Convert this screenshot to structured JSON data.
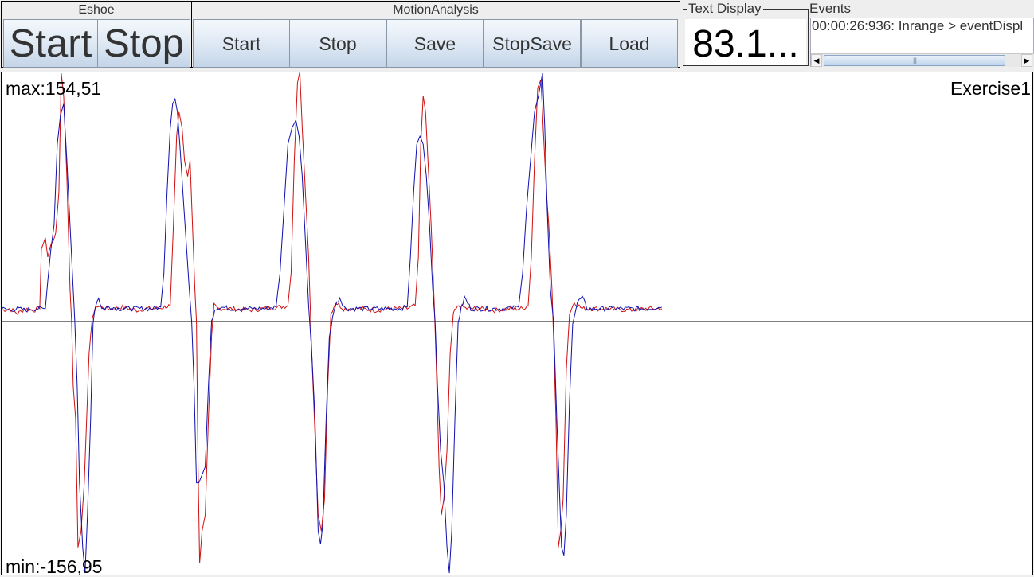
{
  "eshoe": {
    "title": "Eshoe",
    "start_label": "Start",
    "stop_label": "Stop"
  },
  "motion_analysis": {
    "title": "MotionAnalysis",
    "buttons": [
      "Start",
      "Stop",
      "Save",
      "StopSave",
      "Load"
    ]
  },
  "text_display": {
    "title": "Text Display",
    "value": "83.1..."
  },
  "events": {
    "title": "Events",
    "items": [
      "00:00:26:936: Inrange > eventDispl"
    ],
    "scroll_left_icon": "◀",
    "scroll_right_icon": "▶",
    "thumb_grip": "|||"
  },
  "colors": {
    "series_red": "#d01010",
    "series_blue": "#1010b0",
    "axis": "#000000"
  },
  "chart_data": {
    "type": "line",
    "title": "Exercise1",
    "max_label": "max:154,51",
    "min_label": "min:-156,95",
    "ylim": [
      -156.95,
      154.51
    ],
    "xlim": [
      0,
      1296
    ],
    "grid": false,
    "zero_line": true,
    "series": [
      {
        "name": "red",
        "color": "#d01010",
        "points": [
          [
            0,
            7
          ],
          [
            10,
            8
          ],
          [
            20,
            5
          ],
          [
            30,
            8
          ],
          [
            40,
            7
          ],
          [
            48,
            8
          ],
          [
            50,
            45
          ],
          [
            55,
            52
          ],
          [
            58,
            40
          ],
          [
            62,
            48
          ],
          [
            65,
            50
          ],
          [
            68,
            55
          ],
          [
            72,
            80
          ],
          [
            75,
            154
          ],
          [
            78,
            140
          ],
          [
            82,
            90
          ],
          [
            86,
            20
          ],
          [
            88,
            0
          ],
          [
            90,
            -40
          ],
          [
            93,
            -60
          ],
          [
            96,
            -140
          ],
          [
            100,
            -130
          ],
          [
            104,
            -100
          ],
          [
            110,
            -20
          ],
          [
            114,
            3
          ],
          [
            120,
            10
          ],
          [
            130,
            8
          ],
          [
            140,
            8
          ],
          [
            150,
            9
          ],
          [
            160,
            8
          ],
          [
            170,
            7
          ],
          [
            180,
            8
          ],
          [
            195,
            8
          ],
          [
            205,
            9
          ],
          [
            212,
            10
          ],
          [
            216,
            60
          ],
          [
            220,
            115
          ],
          [
            223,
            130
          ],
          [
            227,
            120
          ],
          [
            230,
            100
          ],
          [
            234,
            90
          ],
          [
            237,
            100
          ],
          [
            240,
            60
          ],
          [
            243,
            20
          ],
          [
            245,
            0
          ],
          [
            247,
            -90
          ],
          [
            249,
            -150
          ],
          [
            252,
            -130
          ],
          [
            256,
            -120
          ],
          [
            260,
            -60
          ],
          [
            264,
            -10
          ],
          [
            267,
            10
          ],
          [
            272,
            8
          ],
          [
            290,
            8
          ],
          [
            310,
            7
          ],
          [
            330,
            8
          ],
          [
            350,
            9
          ],
          [
            360,
            10
          ],
          [
            364,
            30
          ],
          [
            368,
            100
          ],
          [
            372,
            148
          ],
          [
            375,
            155
          ],
          [
            378,
            120
          ],
          [
            382,
            80
          ],
          [
            386,
            40
          ],
          [
            388,
            10
          ],
          [
            390,
            -20
          ],
          [
            394,
            -70
          ],
          [
            398,
            -120
          ],
          [
            402,
            -130
          ],
          [
            406,
            -110
          ],
          [
            410,
            -40
          ],
          [
            414,
            5
          ],
          [
            420,
            12
          ],
          [
            430,
            8
          ],
          [
            450,
            8
          ],
          [
            470,
            7
          ],
          [
            490,
            8
          ],
          [
            510,
            8
          ],
          [
            520,
            10
          ],
          [
            524,
            40
          ],
          [
            527,
            110
          ],
          [
            530,
            140
          ],
          [
            533,
            130
          ],
          [
            536,
            100
          ],
          [
            540,
            60
          ],
          [
            544,
            10
          ],
          [
            546,
            -20
          ],
          [
            550,
            -90
          ],
          [
            553,
            -120
          ],
          [
            556,
            -110
          ],
          [
            560,
            -80
          ],
          [
            564,
            -20
          ],
          [
            568,
            5
          ],
          [
            575,
            10
          ],
          [
            585,
            8
          ],
          [
            600,
            8
          ],
          [
            620,
            7
          ],
          [
            640,
            8
          ],
          [
            655,
            8
          ],
          [
            662,
            10
          ],
          [
            666,
            40
          ],
          [
            670,
            100
          ],
          [
            674,
            145
          ],
          [
            678,
            150
          ],
          [
            681,
            120
          ],
          [
            685,
            80
          ],
          [
            688,
            60
          ],
          [
            692,
            20
          ],
          [
            694,
            -10
          ],
          [
            697,
            -60
          ],
          [
            700,
            -140
          ],
          [
            703,
            -130
          ],
          [
            706,
            -110
          ],
          [
            710,
            -30
          ],
          [
            714,
            5
          ],
          [
            720,
            12
          ],
          [
            730,
            8
          ],
          [
            760,
            8
          ],
          [
            790,
            7
          ],
          [
            810,
            8
          ],
          [
            830,
            8
          ]
        ]
      },
      {
        "name": "blue",
        "color": "#1010b0",
        "points": [
          [
            0,
            8
          ],
          [
            10,
            7
          ],
          [
            20,
            8
          ],
          [
            30,
            7
          ],
          [
            40,
            8
          ],
          [
            55,
            8
          ],
          [
            58,
            25
          ],
          [
            62,
            45
          ],
          [
            66,
            60
          ],
          [
            70,
            110
          ],
          [
            74,
            128
          ],
          [
            78,
            135
          ],
          [
            82,
            100
          ],
          [
            86,
            60
          ],
          [
            90,
            20
          ],
          [
            92,
            0
          ],
          [
            95,
            -40
          ],
          [
            98,
            -100
          ],
          [
            102,
            -140
          ],
          [
            105,
            -156
          ],
          [
            108,
            -120
          ],
          [
            112,
            -60
          ],
          [
            115,
            0
          ],
          [
            118,
            10
          ],
          [
            122,
            15
          ],
          [
            126,
            8
          ],
          [
            135,
            9
          ],
          [
            150,
            8
          ],
          [
            170,
            8
          ],
          [
            190,
            8
          ],
          [
            200,
            9
          ],
          [
            204,
            30
          ],
          [
            208,
            80
          ],
          [
            212,
            120
          ],
          [
            215,
            135
          ],
          [
            218,
            138
          ],
          [
            221,
            130
          ],
          [
            224,
            110
          ],
          [
            228,
            80
          ],
          [
            232,
            50
          ],
          [
            236,
            20
          ],
          [
            239,
            0
          ],
          [
            242,
            -40
          ],
          [
            245,
            -100
          ],
          [
            248,
            -100
          ],
          [
            252,
            -95
          ],
          [
            256,
            -90
          ],
          [
            260,
            -40
          ],
          [
            264,
            0
          ],
          [
            268,
            8
          ],
          [
            275,
            9
          ],
          [
            290,
            8
          ],
          [
            310,
            8
          ],
          [
            330,
            8
          ],
          [
            345,
            9
          ],
          [
            350,
            30
          ],
          [
            355,
            70
          ],
          [
            360,
            110
          ],
          [
            365,
            120
          ],
          [
            370,
            125
          ],
          [
            374,
            115
          ],
          [
            378,
            90
          ],
          [
            382,
            50
          ],
          [
            386,
            10
          ],
          [
            390,
            -20
          ],
          [
            394,
            -60
          ],
          [
            398,
            -130
          ],
          [
            401,
            -138
          ],
          [
            404,
            -125
          ],
          [
            408,
            -60
          ],
          [
            412,
            -10
          ],
          [
            418,
            8
          ],
          [
            425,
            15
          ],
          [
            432,
            8
          ],
          [
            450,
            8
          ],
          [
            480,
            8
          ],
          [
            500,
            8
          ],
          [
            510,
            9
          ],
          [
            514,
            40
          ],
          [
            518,
            80
          ],
          [
            522,
            110
          ],
          [
            526,
            115
          ],
          [
            530,
            110
          ],
          [
            534,
            90
          ],
          [
            538,
            60
          ],
          [
            542,
            20
          ],
          [
            545,
            0
          ],
          [
            548,
            -40
          ],
          [
            552,
            -80
          ],
          [
            556,
            -100
          ],
          [
            560,
            -140
          ],
          [
            563,
            -156
          ],
          [
            566,
            -130
          ],
          [
            570,
            -60
          ],
          [
            574,
            0
          ],
          [
            578,
            8
          ],
          [
            582,
            15
          ],
          [
            590,
            8
          ],
          [
            610,
            8
          ],
          [
            630,
            8
          ],
          [
            650,
            9
          ],
          [
            655,
            30
          ],
          [
            660,
            70
          ],
          [
            665,
            100
          ],
          [
            670,
            130
          ],
          [
            675,
            140
          ],
          [
            680,
            154
          ],
          [
            683,
            120
          ],
          [
            686,
            70
          ],
          [
            690,
            20
          ],
          [
            694,
            0
          ],
          [
            698,
            -60
          ],
          [
            701,
            -100
          ],
          [
            704,
            -140
          ],
          [
            707,
            -145
          ],
          [
            710,
            -120
          ],
          [
            714,
            -50
          ],
          [
            718,
            0
          ],
          [
            724,
            12
          ],
          [
            730,
            15
          ],
          [
            736,
            8
          ],
          [
            760,
            8
          ],
          [
            790,
            8
          ],
          [
            810,
            8
          ],
          [
            830,
            9
          ]
        ]
      }
    ]
  }
}
